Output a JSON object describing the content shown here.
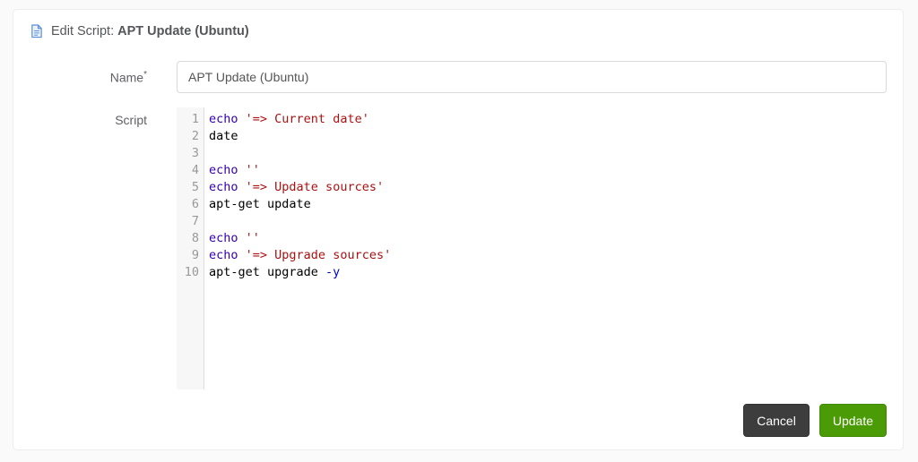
{
  "header": {
    "icon": "file-text-icon",
    "prefix": "Edit Script: ",
    "script_name": "APT Update (Ubuntu)"
  },
  "form": {
    "name": {
      "label": "Name",
      "required_marker": "*",
      "value": "APT Update (Ubuntu)"
    },
    "script": {
      "label": "Script",
      "lines": [
        {
          "n": "1",
          "tokens": [
            {
              "type": "builtin",
              "text": "echo"
            },
            {
              "type": "plain",
              "text": " "
            },
            {
              "type": "string",
              "text": "'=> Current date'"
            }
          ]
        },
        {
          "n": "2",
          "tokens": [
            {
              "type": "plain",
              "text": "date"
            }
          ]
        },
        {
          "n": "3",
          "tokens": []
        },
        {
          "n": "4",
          "tokens": [
            {
              "type": "builtin",
              "text": "echo"
            },
            {
              "type": "plain",
              "text": " "
            },
            {
              "type": "string",
              "text": "''"
            }
          ]
        },
        {
          "n": "5",
          "tokens": [
            {
              "type": "builtin",
              "text": "echo"
            },
            {
              "type": "plain",
              "text": " "
            },
            {
              "type": "string",
              "text": "'=> Update sources'"
            }
          ]
        },
        {
          "n": "6",
          "tokens": [
            {
              "type": "plain",
              "text": "apt-get update"
            }
          ]
        },
        {
          "n": "7",
          "tokens": []
        },
        {
          "n": "8",
          "tokens": [
            {
              "type": "builtin",
              "text": "echo"
            },
            {
              "type": "plain",
              "text": " "
            },
            {
              "type": "string",
              "text": "''"
            }
          ]
        },
        {
          "n": "9",
          "tokens": [
            {
              "type": "builtin",
              "text": "echo"
            },
            {
              "type": "plain",
              "text": " "
            },
            {
              "type": "string",
              "text": "'=> Upgrade sources'"
            }
          ]
        },
        {
          "n": "10",
          "tokens": [
            {
              "type": "plain",
              "text": "apt-get upgrade "
            },
            {
              "type": "attribute",
              "text": "-y"
            }
          ]
        }
      ]
    }
  },
  "actions": {
    "cancel_label": "Cancel",
    "update_label": "Update"
  },
  "colors": {
    "page_bg": "#fafafa",
    "icon_blue": "#5b8fd9",
    "icon_fill": "#eaf1fb",
    "accent_green": "#4a9b06",
    "accent_green_border": "#418a05",
    "dark_button": "#3d3d3d",
    "dark_button_border": "#333333",
    "code_builtin": "#3300aa",
    "code_string": "#aa1111",
    "code_attribute": "#0000cc"
  }
}
